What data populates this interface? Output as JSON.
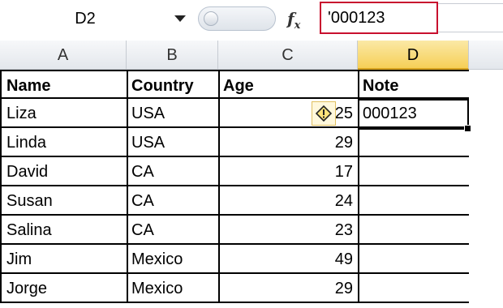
{
  "formula_bar": {
    "name_box": "D2",
    "fx_label": "fx",
    "formula_value": "'000123"
  },
  "columns": [
    "A",
    "B",
    "C",
    "D"
  ],
  "rows": [
    {
      "a": "Name",
      "b": "Country",
      "c": "Age",
      "d": "Note"
    },
    {
      "a": "Liza",
      "b": "USA",
      "c": "25",
      "d": "000123"
    },
    {
      "a": "Linda",
      "b": "USA",
      "c": "29",
      "d": ""
    },
    {
      "a": "David",
      "b": "CA",
      "c": "17",
      "d": ""
    },
    {
      "a": "Susan",
      "b": "CA",
      "c": "24",
      "d": ""
    },
    {
      "a": "Salina",
      "b": "CA",
      "c": "23",
      "d": ""
    },
    {
      "a": "Jim",
      "b": "Mexico",
      "c": "49",
      "d": ""
    },
    {
      "a": "Jorge",
      "b": "Mexico",
      "c": "29",
      "d": ""
    }
  ],
  "warning_icon": "exclamation-diamond-icon",
  "colors": {
    "active_header": "#f6cf57",
    "formula_highlight": "#c8102e"
  }
}
